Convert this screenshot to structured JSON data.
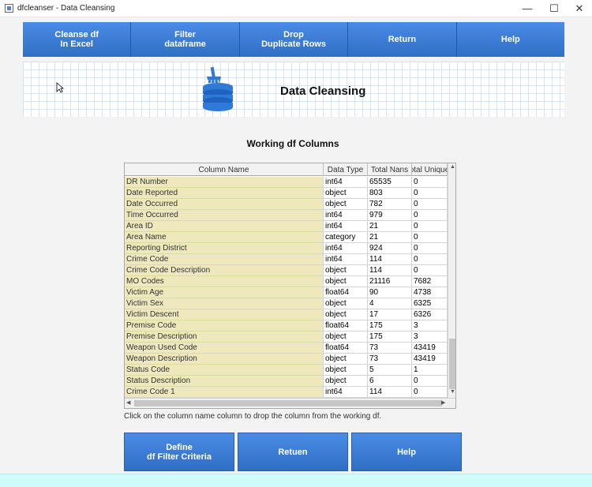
{
  "window": {
    "title": "dfcleanser - Data Cleansing",
    "controls": {
      "minimize": "—",
      "maximize": "☐",
      "close": "✕"
    }
  },
  "topnav": [
    {
      "label": "Cleanse df\nIn Excel"
    },
    {
      "label": "Filter\ndataframe"
    },
    {
      "label": "Drop\nDuplicate Rows"
    },
    {
      "label": "Return"
    },
    {
      "label": "Help"
    }
  ],
  "banner": {
    "title": "Data Cleansing",
    "icon": "database-broom-icon"
  },
  "section": {
    "title": "Working df Columns"
  },
  "table": {
    "headers": [
      "Column Name",
      "Data Type",
      "Total Nans",
      "Total Uniques"
    ],
    "rows": [
      [
        "DR Number",
        "int64",
        "65535",
        "0"
      ],
      [
        "Date Reported",
        "object",
        "803",
        "0"
      ],
      [
        "Date Occurred",
        "object",
        "782",
        "0"
      ],
      [
        "Time Occurred",
        "int64",
        "979",
        "0"
      ],
      [
        "Area ID",
        "int64",
        "21",
        "0"
      ],
      [
        "Area Name",
        "category",
        "21",
        "0"
      ],
      [
        "Reporting District",
        "int64",
        "924",
        "0"
      ],
      [
        "Crime Code",
        "int64",
        "114",
        "0"
      ],
      [
        "Crime Code Description",
        "object",
        "114",
        "0"
      ],
      [
        "MO Codes",
        "object",
        "21116",
        "7682"
      ],
      [
        "Victim Age",
        "float64",
        "90",
        "4738"
      ],
      [
        "Victim Sex",
        "object",
        "4",
        "6325"
      ],
      [
        "Victim Descent",
        "object",
        "17",
        "6326"
      ],
      [
        "Premise Code",
        "float64",
        "175",
        "3"
      ],
      [
        "Premise Description",
        "object",
        "175",
        "3"
      ],
      [
        "Weapon Used Code",
        "float64",
        "73",
        "43419"
      ],
      [
        "Weapon Description",
        "object",
        "73",
        "43419"
      ],
      [
        "Status Code",
        "object",
        "5",
        "1"
      ],
      [
        "Status Description",
        "object",
        "6",
        "0"
      ],
      [
        "Crime Code 1",
        "int64",
        "114",
        "0"
      ]
    ]
  },
  "hint": "Click on the column name column to drop the column from the working df.",
  "bottom_buttons": [
    {
      "label": "Define\ndf Filter Criteria"
    },
    {
      "label": "Retuen"
    },
    {
      "label": "Help"
    }
  ],
  "colors": {
    "button_blue": "#3a7bd5",
    "name_cell_bg": "#efe8bd",
    "bottom_strip": "#cffcfb"
  }
}
